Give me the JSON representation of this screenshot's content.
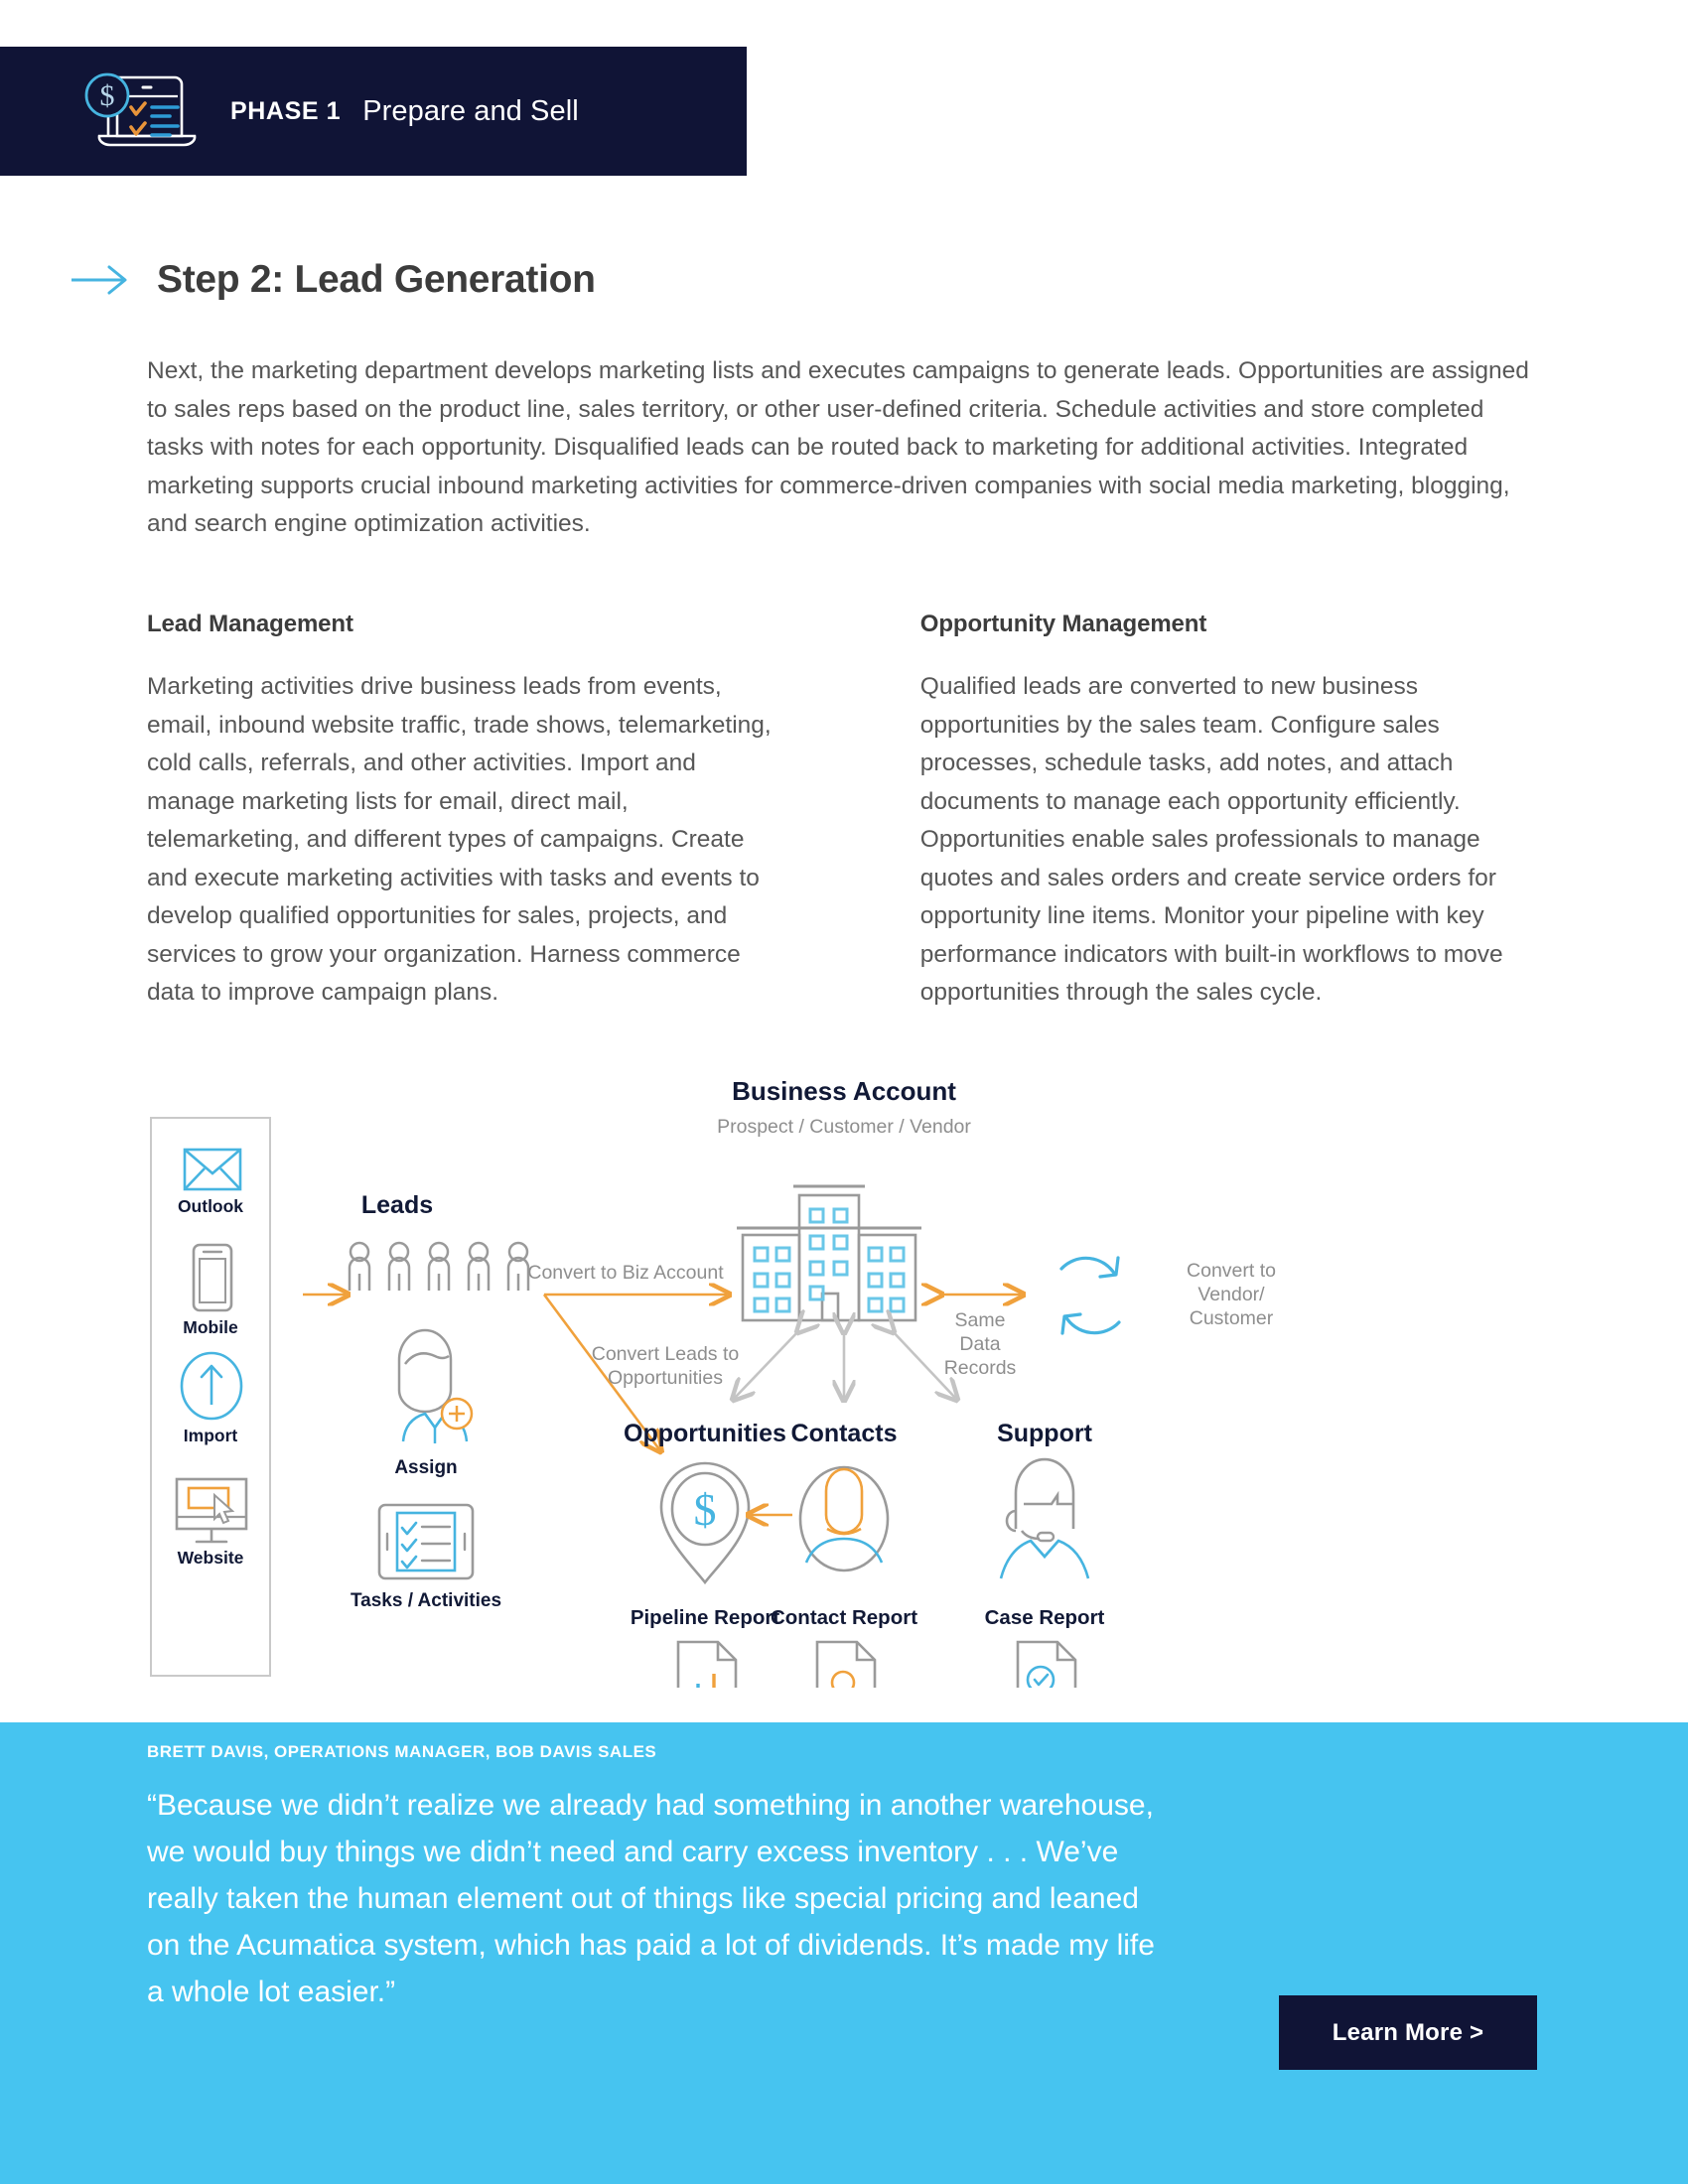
{
  "phase": {
    "label": "PHASE 1",
    "title": "Prepare and Sell",
    "bar_color": "#101436",
    "icon": "laptop-dollar-checklist-icon"
  },
  "step": {
    "arrow_icon": "arrow-right-icon",
    "title": "Step 2: Lead Generation",
    "intro": "Next, the marketing department develops marketing lists and executes campaigns to generate leads. Opportunities are assigned to sales reps based on the product line, sales territory, or other user-defined criteria. Schedule activities and store completed tasks with notes for each opportunity. Disqualified leads can be routed back to marketing for additional activities. Integrated marketing supports crucial inbound marketing activities for commerce-driven companies with social media marketing, blogging, and search engine optimization activities."
  },
  "columns": [
    {
      "heading": "Lead Management",
      "body": "Marketing activities drive business leads from events, email, inbound website traffic, trade shows, telemarketing, cold calls, referrals, and other activities. Import and manage marketing lists for email, direct mail, telemarketing, and different types of campaigns. Create and execute marketing activities with tasks and events to develop qualified opportunities for sales, projects, and services to grow your organization. Harness commerce data to improve campaign plans."
    },
    {
      "heading": "Opportunity Management",
      "body": "Qualified leads are converted to new business opportunities by the sales team. Configure sales processes, schedule tasks, add notes, and attach documents to manage each opportunity efficiently. Opportunities enable sales professionals to manage quotes and sales orders and create service orders for opportunity line items. Monitor your pipeline with key performance indicators with built-in workflows to move opportunities through the sales cycle."
    }
  ],
  "diagram": {
    "channels": [
      {
        "label": "Outlook",
        "icon": "envelope-icon"
      },
      {
        "label": "Mobile",
        "icon": "mobile-phone-icon"
      },
      {
        "label": "Import",
        "icon": "upload-arrow-circle-icon"
      },
      {
        "label": "Website",
        "icon": "monitor-cursor-icon"
      }
    ],
    "leads": {
      "label": "Leads",
      "icon": "people-group-icon",
      "count": 5
    },
    "assign": {
      "label": "Assign",
      "icon": "person-plus-icon"
    },
    "tasks": {
      "label": "Tasks / Activities",
      "icon": "tablet-checklist-icon"
    },
    "business_account": {
      "title": "Business Account",
      "subtitle": "Prospect / Customer / Vendor",
      "icon": "office-building-icon"
    },
    "convert_vendor": {
      "label": "Convert to Vendor/ Customer",
      "icon": "refresh-cycle-icon"
    },
    "edge_labels": {
      "convert_biz": "Convert to Biz Account",
      "convert_opp": "Convert Leads to Opportunities",
      "same_data": "Same Data Records"
    },
    "nodes": [
      {
        "title": "Opportunities",
        "icon": "map-pin-dollar-icon",
        "report_label": "Pipeline Report",
        "report_icon": "document-bar-chart-icon"
      },
      {
        "title": "Contacts",
        "icon": "person-avatar-icon",
        "report_label": "Contact Report",
        "report_icon": "document-person-icon"
      },
      {
        "title": "Support",
        "icon": "headset-agent-icon",
        "report_label": "Case Report",
        "report_icon": "document-check-alert-icon"
      }
    ],
    "colors": {
      "orange": "#f0a13c",
      "blue": "#46b4e0",
      "gray": "#a0a0a0",
      "dark": "#111936"
    }
  },
  "quote": {
    "text": "“Because we didn’t realize we already had something in another warehouse, we would buy things we didn’t need and carry excess inventory . . . We’ve really taken the human element out of things like special pricing and leaned on the Acumatica system, which has paid a lot of dividends. It’s made my life a whole lot easier.”",
    "attribution": "BRETT DAVIS, OPERATIONS MANAGER, BOB DAVIS SALES",
    "band_color": "#46c4f0",
    "cta_label": "Learn More >"
  }
}
